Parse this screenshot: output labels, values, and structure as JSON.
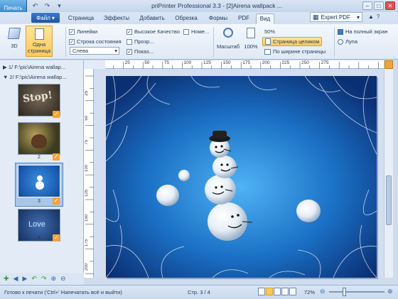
{
  "titlebar": {
    "print_label": "Печать",
    "title": "priPrinter Professional 3.3 - [2]Airena wallpack ...",
    "expert": "Expert PDF"
  },
  "tabs": {
    "file": "Файл",
    "items": [
      "Страница",
      "Эффекты",
      "Добавить",
      "Обрезка",
      "Формы",
      "PDF",
      "Вид"
    ]
  },
  "ribbon": {
    "btn_3d": "3D",
    "one_page_1": "Одна",
    "one_page_2": "страница",
    "rulers": "Линейки",
    "status_bar": "Строка состояния",
    "align_value": "Слева",
    "high_quality": "Высокое Качество",
    "numbers": "Номе...",
    "transparent": "Прозр...",
    "show": "Показ...",
    "scale": "Масштаб",
    "percent_100": "100%",
    "zoom_50": "50%",
    "whole_page": "Страница целиком",
    "page_width": "По ширине страницы",
    "full_screen": "На полный экран",
    "magnifier": "Лупа"
  },
  "tree": {
    "item1": "1/ F:\\pic\\Airena wallap...",
    "item2": "2/ F:\\pic\\Airena wallap..."
  },
  "thumbs": [
    {
      "num": "1",
      "caption": "Stop!"
    },
    {
      "num": "2",
      "caption": ""
    },
    {
      "num": "3",
      "caption": ""
    },
    {
      "num": "4",
      "caption": "Love"
    }
  ],
  "ruler": {
    "h": [
      "25",
      "50",
      "75",
      "100",
      "125",
      "150",
      "175",
      "200",
      "225",
      "250",
      "275"
    ],
    "v": [
      "25",
      "50",
      "75",
      "100",
      "125",
      "150",
      "175",
      "200"
    ]
  },
  "status": {
    "ready": "Готово к печати ('Ctrl+' Напечатать всё и выйти)",
    "page": "Стр. 3 / 4",
    "zoom": "72%"
  },
  "colors": {
    "accent": "#2a7cc4",
    "highlight": "#ffc95a",
    "page_bg": "#1a6fc4"
  }
}
